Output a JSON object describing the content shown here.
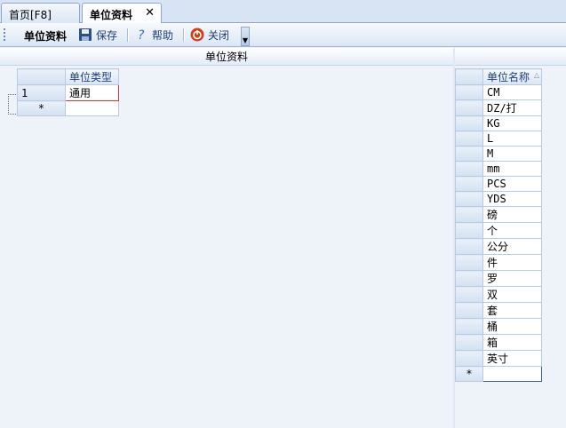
{
  "tabs": {
    "home": "首页[F8]",
    "active": "单位资料",
    "close": "✕"
  },
  "toolbar": {
    "title": "单位资料",
    "save": "保存",
    "help": "帮助",
    "close": "关闭"
  },
  "panel": {
    "header": "单位资料"
  },
  "type_grid": {
    "column": "单位类型",
    "rows": [
      {
        "num": "1",
        "value": "通用"
      }
    ],
    "new_row_marker": "*"
  },
  "name_grid": {
    "column": "单位名称",
    "sort_indicator": "△",
    "rows": [
      "CM",
      "DZ/打",
      "KG",
      "L",
      "M",
      "mm",
      "PCS",
      "YDS",
      "磅",
      "个",
      "公分",
      "件",
      "罗",
      "双",
      "套",
      "桶",
      "箱",
      "英寸"
    ],
    "new_row_marker": "*"
  }
}
